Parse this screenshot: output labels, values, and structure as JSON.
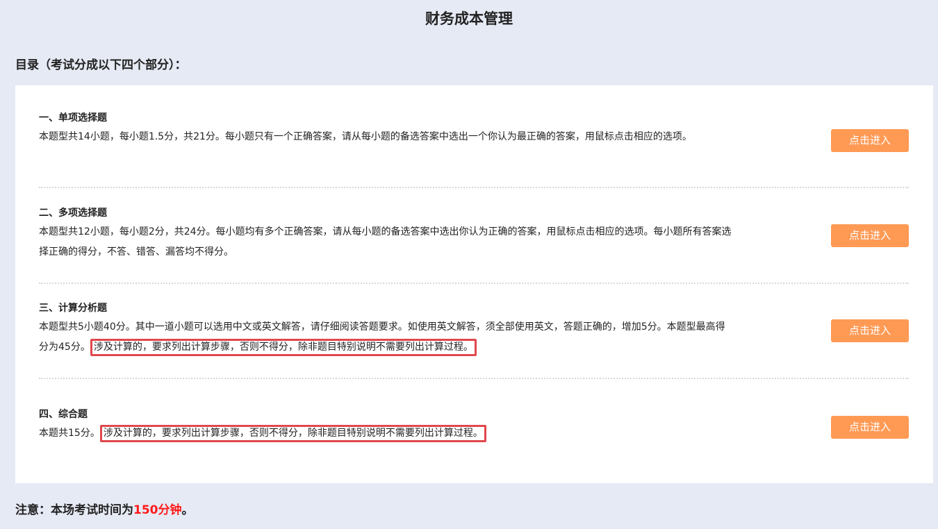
{
  "page": {
    "title": "财务成本管理"
  },
  "toc": {
    "heading": "目录（考试分成以下四个部分）："
  },
  "sections": [
    {
      "title": "一、单项选择题",
      "desc": "本题型共14小题，每小题1.5分，共21分。每小题只有一个正确答案，请从每小题的备选答案中选出一个你认为最正确的答案，用鼠标点击相应的选项。",
      "highlight": "",
      "button_label": "点击进入"
    },
    {
      "title": "二、多项选择题",
      "desc": "本题型共12小题，每小题2分，共24分。每小题均有多个正确答案，请从每小题的备选答案中选出你认为正确的答案，用鼠标点击相应的选项。每小题所有答案选择正确的得分，不答、错答、漏答均不得分。",
      "highlight": "",
      "button_label": "点击进入"
    },
    {
      "title": "三、计算分析题",
      "desc": "本题型共5小题40分。其中一道小题可以选用中文或英文解答，请仔细阅读答题要求。如使用英文解答，须全部使用英文，答题正确的，增加5分。本题型最高得分为45分。",
      "highlight": "涉及计算的，要求列出计算步骤，否则不得分，除非题目特别说明不需要列出计算过程。",
      "button_label": "点击进入"
    },
    {
      "title": "四、综合题",
      "desc": "本题共15分。",
      "highlight": "涉及计算的，要求列出计算步骤，否则不得分，除非题目特别说明不需要列出计算过程。",
      "button_label": "点击进入"
    }
  ],
  "notice": {
    "prefix": "注意：本场考试时间为",
    "time": "150分钟",
    "suffix": "。"
  },
  "colors": {
    "background": "#e6eaf4",
    "button": "#ff9a55",
    "highlight_border": "#e0474c",
    "time_text": "#ff1a1a"
  }
}
